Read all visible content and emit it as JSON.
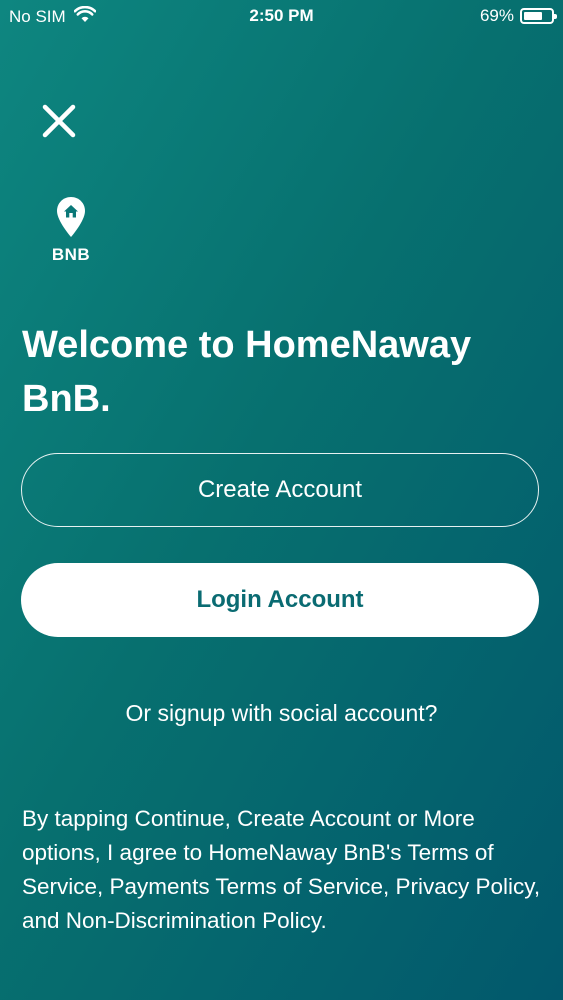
{
  "status_bar": {
    "carrier": "No SIM",
    "time": "2:50 PM",
    "battery_percent": "69%",
    "battery_level": 0.69,
    "icons": [
      "wifi-icon",
      "battery-icon"
    ]
  },
  "close_icon": "close-icon",
  "logo": {
    "icon": "home-location-pin-icon",
    "text": "BNB"
  },
  "welcome_title": "Welcome to HomeNaway BnB.",
  "buttons": {
    "create_account": "Create Account",
    "login_account": "Login Account"
  },
  "social_link": "Or signup with social account?",
  "terms_text": "By tapping Continue, Create Account or More options, I agree to HomeNaway BnB's Terms of Service, Payments Terms of Service, Privacy Policy, and Non-Discrimination Policy.",
  "colors": {
    "background_start": "#0e8680",
    "background_end": "#02586c",
    "login_text": "#0a6b72",
    "white": "#ffffff"
  }
}
